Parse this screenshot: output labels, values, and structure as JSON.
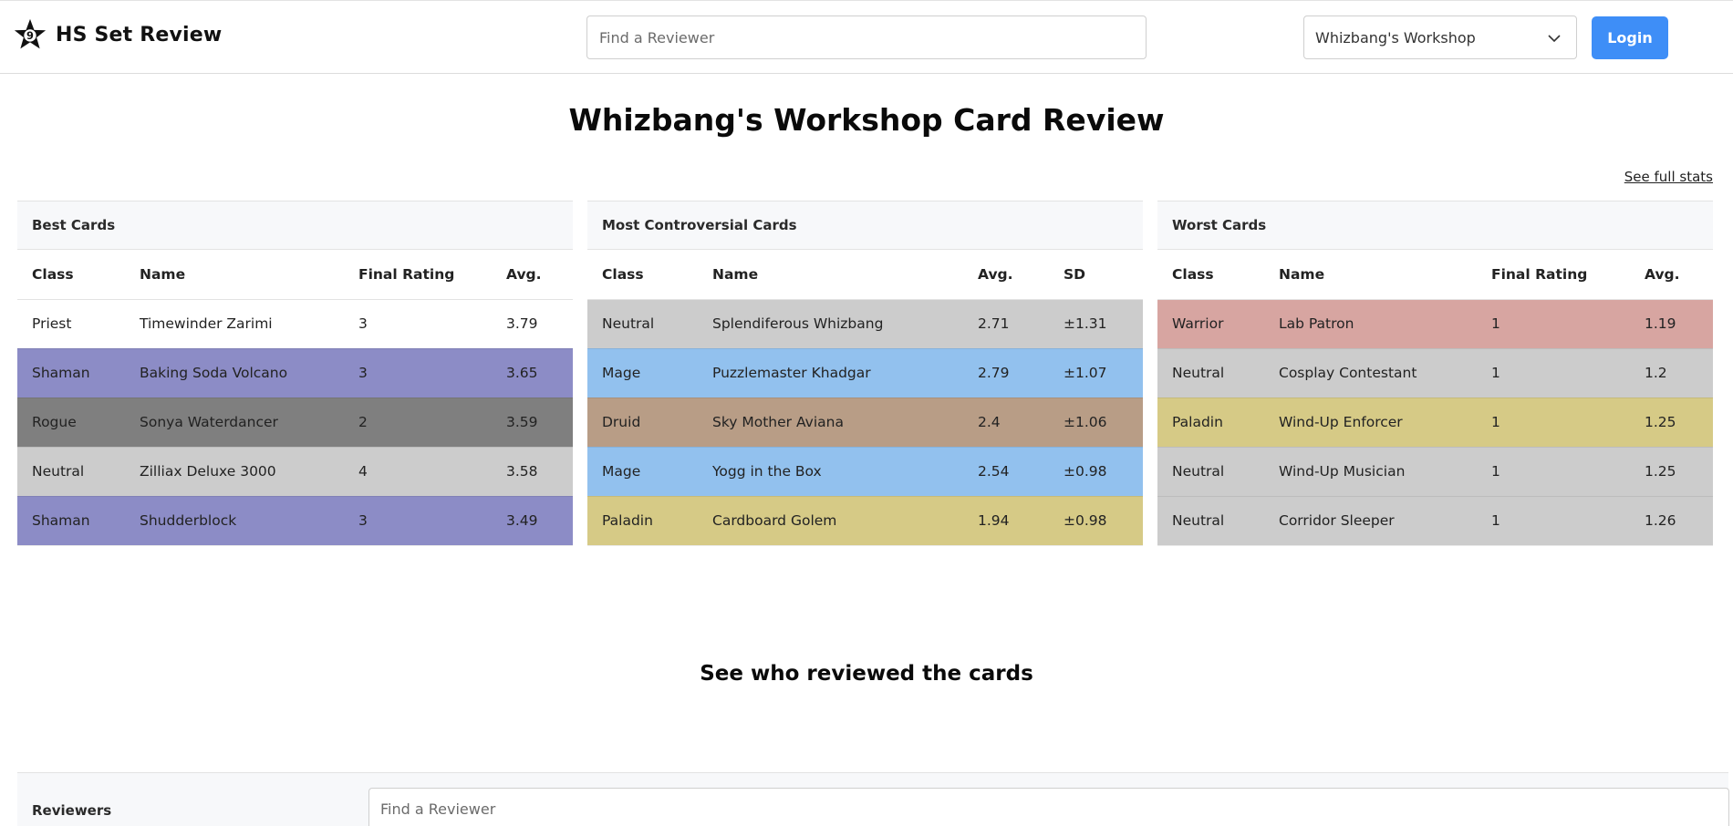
{
  "header": {
    "brand": "HS Set Review",
    "search_placeholder": "Find a Reviewer",
    "set_selected": "Whizbang's Workshop",
    "login_label": "Login"
  },
  "main": {
    "title": "Whizbang's Workshop Card Review",
    "see_full_stats": "See full stats"
  },
  "colors": {
    "Priest": "#ffffff",
    "Shaman": "#8c8cc6",
    "Rogue": "#7f7f7f",
    "Neutral": "#cccccc",
    "Mage": "#92c1ee",
    "Druid": "#b89d86",
    "Paladin": "#d6ca86",
    "Warrior": "#d7a5a1",
    "login_button": "#3e8ef7"
  },
  "tables": {
    "best": {
      "title": "Best Cards",
      "columns": [
        "Class",
        "Name",
        "Final Rating",
        "Avg."
      ],
      "rows": [
        {
          "class": "Priest",
          "name": "Timewinder Zarimi",
          "rating": "3",
          "avg": "3.79"
        },
        {
          "class": "Shaman",
          "name": "Baking Soda Volcano",
          "rating": "3",
          "avg": "3.65"
        },
        {
          "class": "Rogue",
          "name": "Sonya Waterdancer",
          "rating": "2",
          "avg": "3.59"
        },
        {
          "class": "Neutral",
          "name": "Zilliax Deluxe 3000",
          "rating": "4",
          "avg": "3.58"
        },
        {
          "class": "Shaman",
          "name": "Shudderblock",
          "rating": "3",
          "avg": "3.49"
        }
      ]
    },
    "controversial": {
      "title": "Most Controversial Cards",
      "columns": [
        "Class",
        "Name",
        "Avg.",
        "SD"
      ],
      "rows": [
        {
          "class": "Neutral",
          "name": "Splendiferous Whizbang",
          "avg": "2.71",
          "sd": "±1.31"
        },
        {
          "class": "Mage",
          "name": "Puzzlemaster Khadgar",
          "avg": "2.79",
          "sd": "±1.07"
        },
        {
          "class": "Druid",
          "name": "Sky Mother Aviana",
          "avg": "2.4",
          "sd": "±1.06"
        },
        {
          "class": "Mage",
          "name": "Yogg in the Box",
          "avg": "2.54",
          "sd": "±0.98"
        },
        {
          "class": "Paladin",
          "name": "Cardboard Golem",
          "avg": "1.94",
          "sd": "±0.98"
        }
      ]
    },
    "worst": {
      "title": "Worst Cards",
      "columns": [
        "Class",
        "Name",
        "Final Rating",
        "Avg."
      ],
      "rows": [
        {
          "class": "Warrior",
          "name": "Lab Patron",
          "rating": "1",
          "avg": "1.19"
        },
        {
          "class": "Neutral",
          "name": "Cosplay Contestant",
          "rating": "1",
          "avg": "1.2"
        },
        {
          "class": "Paladin",
          "name": "Wind-Up Enforcer",
          "rating": "1",
          "avg": "1.25"
        },
        {
          "class": "Neutral",
          "name": "Wind-Up Musician",
          "rating": "1",
          "avg": "1.25"
        },
        {
          "class": "Neutral",
          "name": "Corridor Sleeper",
          "rating": "1",
          "avg": "1.26"
        }
      ]
    }
  },
  "reviewers": {
    "section_title": "See who reviewed the cards",
    "label": "Reviewers",
    "search_placeholder": "Find a Reviewer"
  }
}
